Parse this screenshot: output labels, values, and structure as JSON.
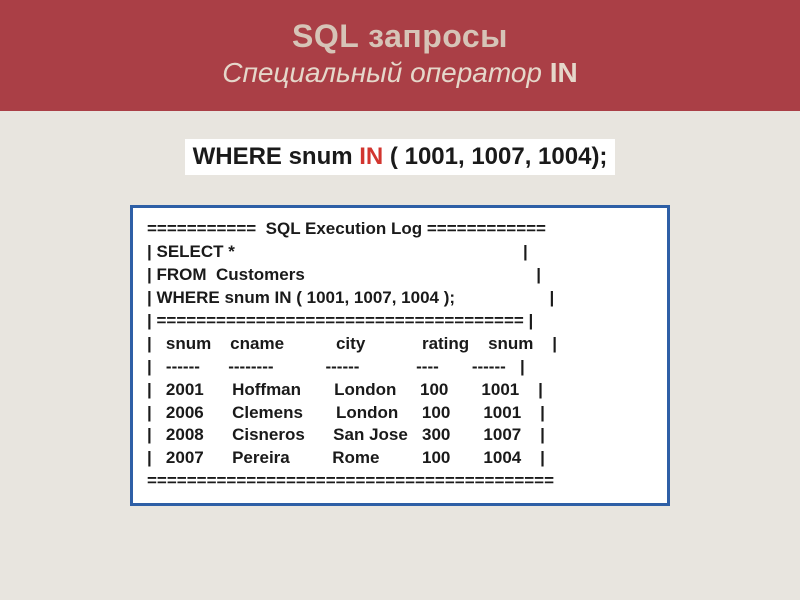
{
  "header": {
    "title": "SQL запросы",
    "subtitle_italic": "Специальный оператор",
    "subtitle_kw": "IN"
  },
  "query": {
    "prefix": "WHERE snum ",
    "kw": "IN",
    "suffix": " ( 1001, 1007, 1004);"
  },
  "log": {
    "line0": "===========  SQL Execution Log ============",
    "line1": "| SELECT *                                                             |",
    "line2": "| FROM  Customers                                                 |",
    "line3": "| WHERE snum IN ( 1001, 1007, 1004 );                    |",
    "line4": "| ===================================== |",
    "line5": "|   snum    cname           city            rating    snum    |",
    "line6": "|   ------      --------           ------            ----       ------   |",
    "line7": "|   2001      Hoffman       London     100       1001    |",
    "line8": "|   2006      Clemens       London     100       1001    |",
    "line9": "|   2008      Cisneros      San Jose   300       1007    |",
    "line10": "|   2007      Pereira         Rome         100       1004    |",
    "line11": "========================================="
  },
  "chart_data": {
    "type": "table",
    "title": "SQL Execution Log",
    "query": "SELECT * FROM Customers WHERE snum IN ( 1001, 1007, 1004 );",
    "columns": [
      "snum",
      "cname",
      "city",
      "rating",
      "snum"
    ],
    "rows": [
      [
        2001,
        "Hoffman",
        "London",
        100,
        1001
      ],
      [
        2006,
        "Clemens",
        "London",
        100,
        1001
      ],
      [
        2008,
        "Cisneros",
        "San Jose",
        300,
        1007
      ],
      [
        2007,
        "Pereira",
        "Rome",
        100,
        1004
      ]
    ]
  }
}
